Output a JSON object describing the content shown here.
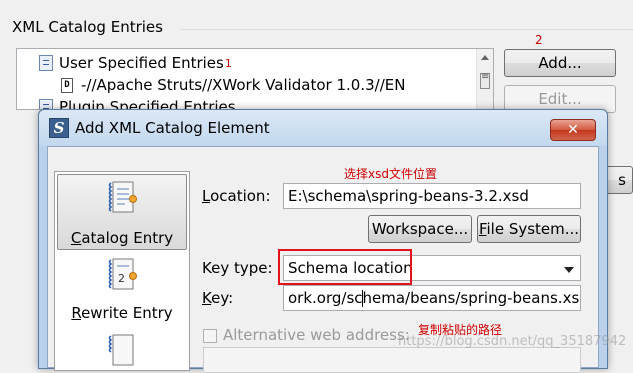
{
  "background": {
    "group_title": "XML Catalog Entries",
    "tree": {
      "user_entries_label": "User Specified Entries",
      "user_entries_marker": "1",
      "entry_label": "-//Apache Struts//XWork Validator 1.0.3//EN",
      "entry_icon_letter": "D",
      "plugin_entries_label": "Plugin Specified Entries"
    },
    "add_button": "Add...",
    "add_button_marker": "2",
    "edit_button": "Edit...",
    "partial_button_glyph": "s"
  },
  "dialog": {
    "title": "Add XML Catalog Element",
    "icon_glyph": "S",
    "close_glyph": "✕",
    "list": [
      {
        "label_first": "C",
        "label_rest": "atalog Entry",
        "selected": true
      },
      {
        "label_first": "R",
        "label_rest": "ewrite Entry",
        "selected": false
      }
    ],
    "location": {
      "label_first": "L",
      "label_rest": "ocation:",
      "value": "E:\\schema\\spring-beans-3.2.xsd",
      "annotation": "选择xsd文件位置"
    },
    "workspace_button": "Workspace...",
    "filesystem_button_first": "F",
    "filesystem_button_rest": "ile System...",
    "key_type": {
      "label": "Key type:",
      "value": "Schema location"
    },
    "key": {
      "label_first": "K",
      "label_rest": "ey:",
      "value": "ork.org/schema/beans/spring-beans.xsd"
    },
    "alt_web_address": {
      "label": "Alternative web address:",
      "annotation": "复制粘贴的路径"
    }
  },
  "watermark": "https://blog.csdn.net/qq_35187942",
  "colors": {
    "annotation_red": "#d00000",
    "highlight_box": "#e0131b",
    "dialog_frame": "#b9d1ea"
  }
}
